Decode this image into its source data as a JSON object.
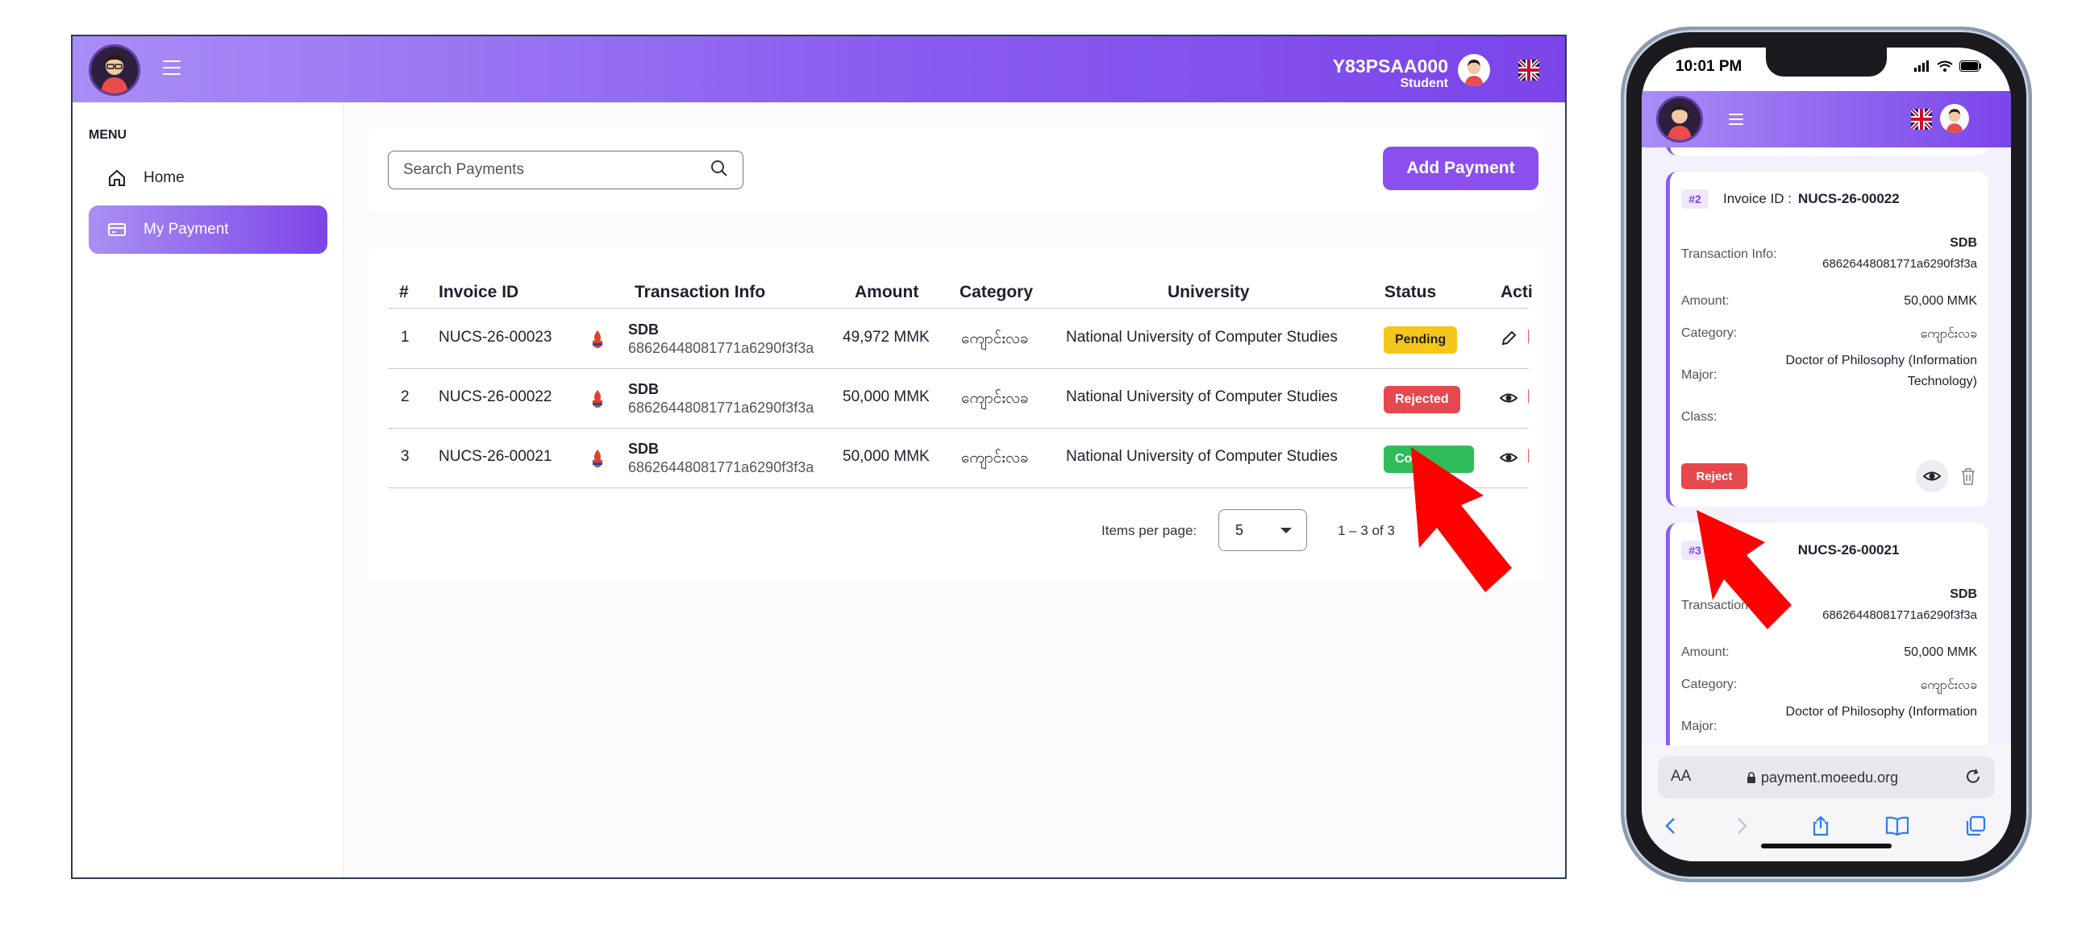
{
  "app": {
    "user_id": "Y83PSAA000",
    "user_role": "Student"
  },
  "sidebar": {
    "menu_title": "MENU",
    "items": [
      {
        "label": "Home",
        "icon": "home-icon"
      },
      {
        "label": "My Payment",
        "icon": "card-icon"
      }
    ]
  },
  "search": {
    "placeholder": "Search Payments"
  },
  "add_button": "Add Payment",
  "table": {
    "headers": [
      "#",
      "Invoice ID",
      "Transaction Info",
      "Amount",
      "Category",
      "University",
      "Status",
      "Acti"
    ],
    "rows": [
      {
        "num": "1",
        "invoice": "NUCS-26-00023",
        "bank": "SDB",
        "tx": "68626448081771a6290f3f3a",
        "amount": "49,972 MMK",
        "category": "ကျောင်းလခ",
        "university": "National University of Computer Studies",
        "status": "Pending"
      },
      {
        "num": "2",
        "invoice": "NUCS-26-00022",
        "bank": "SDB",
        "tx": "68626448081771a6290f3f3a",
        "amount": "50,000 MMK",
        "category": "ကျောင်းလခ",
        "university": "National University of Computer Studies",
        "status": "Rejected"
      },
      {
        "num": "3",
        "invoice": "NUCS-26-00021",
        "bank": "SDB",
        "tx": "68626448081771a6290f3f3a",
        "amount": "50,000 MMK",
        "category": "ကျောင်းလခ",
        "university": "National University of Computer Studies",
        "status": "Co"
      }
    ]
  },
  "pager": {
    "label": "Items per page:",
    "value": "5",
    "range": "1 – 3 of 3"
  },
  "phone": {
    "time": "10:01 PM",
    "url": "payment.moeedu.org",
    "aa": "AA",
    "cards": [
      {
        "num": "#2",
        "title_label": "Invoice ID :",
        "invoice": "NUCS-26-00022",
        "tx_label": "Transaction Info:",
        "bank": "SDB",
        "tx": "68626448081771a6290f3f3a",
        "amount_label": "Amount:",
        "amount": "50,000 MMK",
        "category_label": "Category:",
        "category": "ကျောင်းလခ",
        "major_label": "Major:",
        "major_line1": "Doctor of Philosophy (Information",
        "major_line2": "Technology)",
        "class_label": "Class:",
        "reject_label": "Reject"
      },
      {
        "num": "#3",
        "title_label": "I",
        "invoice": "NUCS-26-00021",
        "tx_label": "Transaction Info:",
        "bank": "SDB",
        "tx": "68626448081771a6290f3f3a",
        "amount_label": "Amount:",
        "amount": "50,000 MMK",
        "category_label": "Category:",
        "category": "ကျောင်းလခ",
        "major_label": "Major:",
        "major_line1": "Doctor of Philosophy (Information"
      }
    ]
  },
  "colors": {
    "accent": "#8b4ff0",
    "pending": "#f5c71a",
    "rejected": "#e5484d",
    "completed": "#2ebd59",
    "arrow": "#ff0000"
  }
}
